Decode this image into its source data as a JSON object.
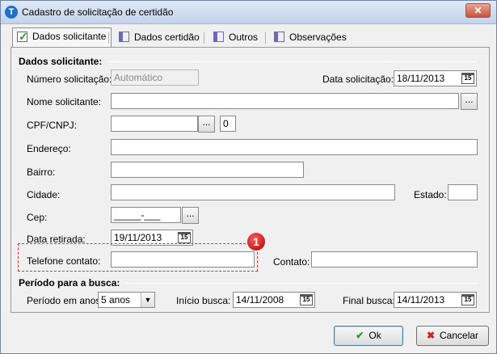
{
  "window": {
    "title": "Cadastro de solicitação de certidão",
    "app_icon": "T",
    "close_glyph": "✕"
  },
  "tabs": [
    {
      "label": "Dados solicitante",
      "active": true
    },
    {
      "label": "Dados certidão"
    },
    {
      "label": "Outros"
    },
    {
      "label": "Observações"
    }
  ],
  "section_dados": {
    "title": "Dados solicitante:",
    "numero_label": "Número solicitação:",
    "numero_value": "Automático",
    "data_solicitacao_label": "Data solicitação:",
    "data_solicitacao_value": "18/11/2013",
    "nome_label": "Nome solicitante:",
    "nome_value": "",
    "cpf_label": "CPF/CNPJ:",
    "cpf_value": "",
    "cpf_extra_value": "0",
    "endereco_label": "Endereço:",
    "bairro_label": "Bairro:",
    "cidade_label": "Cidade:",
    "estado_label": "Estado:",
    "cep_label": "Cep:",
    "cep_value": "_____-___",
    "data_retirada_label": "Data retirada:",
    "data_retirada_value": "19/11/2013",
    "telefone_label": "Telefone contato:",
    "contato_label": "Contato:",
    "ellipsis": "...",
    "cal_glyph": "15"
  },
  "marker": {
    "number": "1"
  },
  "section_periodo": {
    "title": "Período para a busca:",
    "periodo_label": "Período em anos:",
    "periodo_value": "5 anos",
    "inicio_label": "Início busca:",
    "inicio_value": "14/11/2008",
    "final_label": "Final busca:",
    "final_value": "14/11/2013"
  },
  "buttons": {
    "ok": "Ok",
    "cancel": "Cancelar",
    "ok_icon": "✔",
    "cancel_icon": "✖"
  },
  "colors": {
    "ok_icon": "#2a9a2a",
    "cancel_icon": "#d02020",
    "marker": "#c00000"
  }
}
